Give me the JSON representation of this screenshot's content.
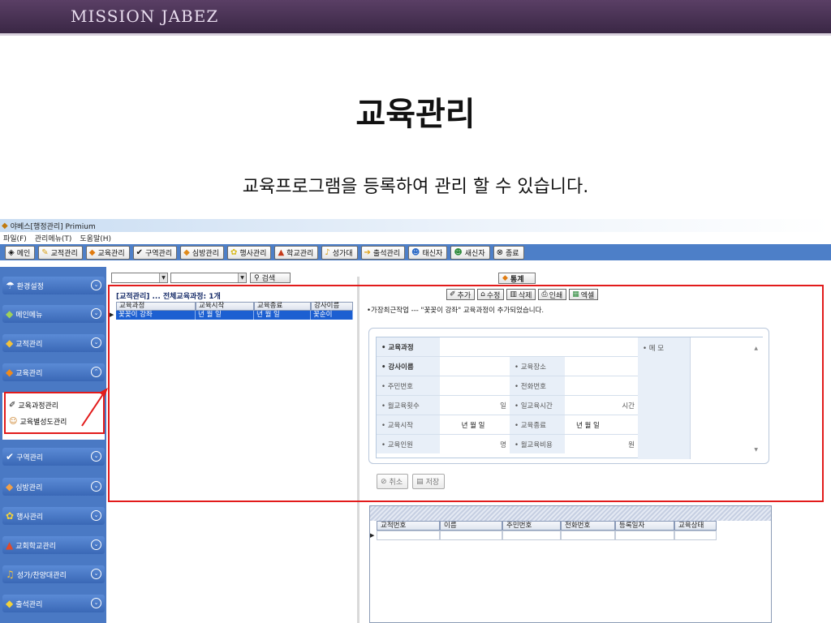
{
  "slide": {
    "brand": "MISSION JABEZ",
    "title": "교육관리",
    "subtitle": "교육프로그램을 등록하여 관리 할 수 있습니다."
  },
  "app": {
    "window_title": "야베스[행정관리] Primium",
    "menu": [
      "파일(F)",
      "관리메뉴(T)",
      "도움말(H)"
    ],
    "toolbar": [
      {
        "label": "메인",
        "icon": "home-icon"
      },
      {
        "label": "교적관리",
        "icon": "folder-icon"
      },
      {
        "label": "교육관리",
        "icon": "book-icon"
      },
      {
        "label": "구역관리",
        "icon": "check-icon"
      },
      {
        "label": "심방관리",
        "icon": "house-icon"
      },
      {
        "label": "행사관리",
        "icon": "flower-icon"
      },
      {
        "label": "학교관리",
        "icon": "school-icon"
      },
      {
        "label": "성가대",
        "icon": "music-icon"
      },
      {
        "label": "출석관리",
        "icon": "attendance-icon"
      },
      {
        "label": "태신자",
        "icon": "people-icon"
      },
      {
        "label": "새신자",
        "icon": "person-icon"
      },
      {
        "label": "종료",
        "icon": "exit-icon"
      }
    ],
    "search_button": "검색",
    "stats_button": "통계",
    "sidebar": {
      "items": [
        {
          "label": "환경설정",
          "icon": "settings-icon",
          "chevron": "⌄"
        },
        {
          "label": "메인메뉴",
          "icon": "main-menu-icon",
          "chevron": "⌄"
        },
        {
          "label": "교적관리",
          "icon": "folder-icon",
          "chevron": "⌄"
        },
        {
          "label": "교육관리",
          "icon": "book-icon",
          "chevron": "⌃"
        },
        {
          "label": "구역관리",
          "icon": "check-icon",
          "chevron": "⌄"
        },
        {
          "label": "심방관리",
          "icon": "house-icon",
          "chevron": "⌄"
        },
        {
          "label": "행사관리",
          "icon": "flower-icon",
          "chevron": "⌄"
        },
        {
          "label": "교회학교관리",
          "icon": "school-icon",
          "chevron": "⌄"
        },
        {
          "label": "성가/찬양대관리",
          "icon": "music-icon",
          "chevron": "⌄"
        },
        {
          "label": "출석관리",
          "icon": "attendance-icon",
          "chevron": "⌄"
        }
      ],
      "sub_items": [
        {
          "label": "교육과정관리",
          "icon": "course-icon"
        },
        {
          "label": "교육별성도관리",
          "icon": "member-icon"
        }
      ]
    },
    "list": {
      "caption": "[교적관리] ... 전체교육과정: 1개",
      "columns": [
        "교육과정",
        "교육시작",
        "교육종료",
        "강사이름"
      ],
      "rows": [
        [
          "꽃꽂이 강좌",
          "년 월 일",
          "년 월 일",
          "꽃순이"
        ]
      ]
    },
    "actions": [
      "추가",
      "수정",
      "삭제",
      "인쇄",
      "엑셀"
    ],
    "recent_note": "•가장최근작업 --- \"꽃꽂이 강좌\" 교육과정이 추가되었습니다.",
    "form": {
      "course": "• 교육과정",
      "instructor": "• 강사이름",
      "place": "• 교육장소",
      "resident_no": "• 주민번호",
      "phone": "• 전화번호",
      "weekly_count": "• 월교육횟수",
      "weekly_count_unit": "일",
      "class_hours": "• 일교육시간",
      "class_hours_unit": "시간",
      "start": "• 교육시작",
      "start_value": "년  월  일",
      "end": "• 교육종료",
      "end_value": "년  월  일",
      "capacity": "• 교육인원",
      "capacity_unit": "명",
      "fee": "• 월교육비용",
      "fee_unit": "원",
      "memo": "• 메 모"
    },
    "form_buttons": [
      "취소",
      "저장"
    ],
    "lower_grid": {
      "columns": [
        "교적번호",
        "이름",
        "주민번호",
        "전화번호",
        "등록일자",
        "교육상태"
      ]
    }
  }
}
